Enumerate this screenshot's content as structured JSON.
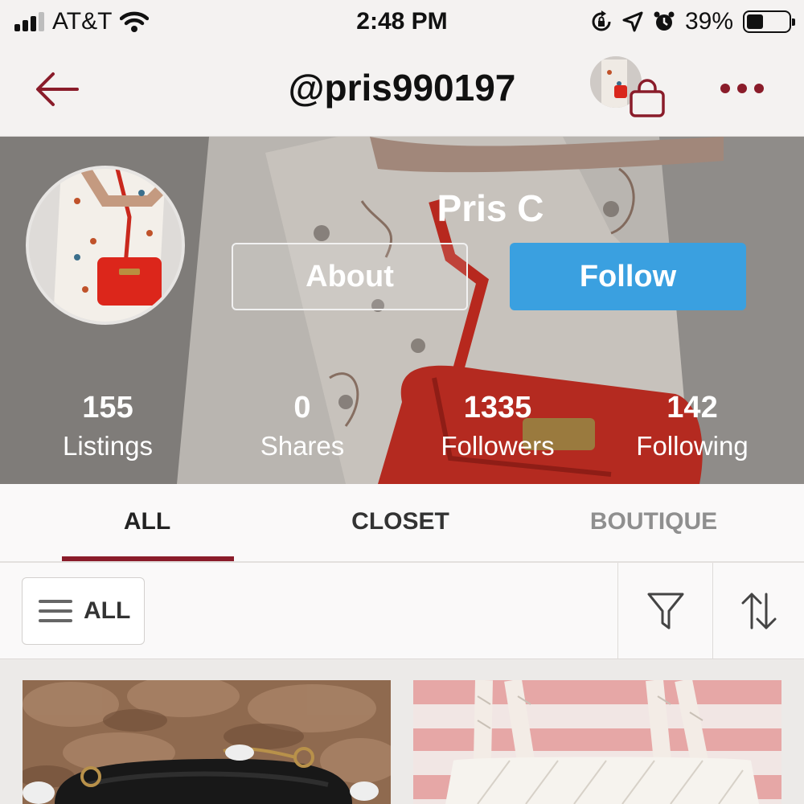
{
  "status_bar": {
    "carrier": "AT&T",
    "time": "2:48 PM",
    "battery": "39%",
    "battery_level": 0.39,
    "icons": [
      "signal-icon",
      "wifi-icon",
      "rotation-lock-icon",
      "location-icon",
      "alarm-icon",
      "battery-icon"
    ]
  },
  "nav": {
    "title": "@pris990197",
    "icons": [
      "back-arrow-icon",
      "shopping-bag-icon",
      "more-icon"
    ]
  },
  "profile": {
    "name": "Pris C",
    "about_label": "About",
    "follow_label": "Follow",
    "stats": [
      {
        "value": "155",
        "label": "Listings"
      },
      {
        "value": "0",
        "label": "Shares"
      },
      {
        "value": "1335",
        "label": "Followers"
      },
      {
        "value": "142",
        "label": "Following"
      }
    ]
  },
  "tabs": [
    {
      "label": "ALL",
      "active": true
    },
    {
      "label": "CLOSET",
      "active": false
    },
    {
      "label": "BOUTIQUE",
      "active": false
    }
  ],
  "filter_bar": {
    "category_label": "ALL",
    "icons": [
      "menu-icon",
      "filter-icon",
      "sort-icon"
    ]
  },
  "colors": {
    "accent": "#8a1c2a",
    "follow_button": "#3aa0e0",
    "tab_active": "#222222",
    "tab_inactive": "#333333",
    "tab_muted": "#8f8f8f"
  }
}
